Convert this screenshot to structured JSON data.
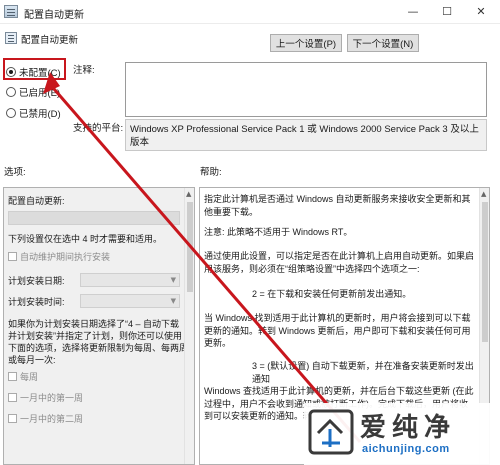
{
  "window": {
    "title": "配置自动更新",
    "controls": {
      "minimize": "—",
      "maximize": "☐",
      "close": "✕"
    }
  },
  "header": {
    "title": "配置自动更新"
  },
  "nav": {
    "prev_label": "上一个设置(P)",
    "next_label": "下一个设置(N)"
  },
  "options": {
    "not_configured": "未配置(C)",
    "enabled": "已启用(E)",
    "disabled": "已禁用(D)",
    "selected": "not_configured"
  },
  "labels": {
    "comment": "注释:",
    "platform": "支持的平台:",
    "options": "选项:",
    "help": "帮助:"
  },
  "platform_text": "Windows XP Professional Service Pack 1 或 Windows 2000 Service Pack 3 及以上版本",
  "options_panel": {
    "heading": "配置自动更新:",
    "note": "下列设置仅在选中 4 时才需要和适用。",
    "maintenance_checkbox": "自动维护期间执行安装",
    "schedule_day_label": "计划安装日期:",
    "schedule_time_label": "计划安装时间:",
    "paragraph": [
      "如果你为计划安装日期选择了“4 – 自动下载",
      "并计划安装”并指定了计划，则你还可以使用",
      "下面的选项，选择将更新限制为每周、每两周",
      "或每月一次:"
    ],
    "weekly": "每周",
    "first_week": "一月中的第一周",
    "second_week": "一月中的第二周"
  },
  "help_panel": {
    "p1": "指定此计算机是否通过 Windows 自动更新服务来接收安全更新和其他重要下载。",
    "p2": "注意: 此策略不适用于 Windows RT。",
    "p3": "通过使用此设置，可以指定是否在此计算机上启用自动更新。如果启用该服务，则必须在“组策略设置”中选择四个选项之一:",
    "p4": "2 = 在下载和安装任何更新前发出通知。",
    "p5": "当 Windows 找到适用于此计算机的更新时，用户将会接到可以下载更新的通知。转到 Windows 更新后，用户即可下载和安装任何可用更新。",
    "p6": "3 = (默认设置) 自动下载更新，并在准备安装更新时发出通知",
    "p7": "Windows 查找适用于此计算机的更新，并在后台下载这些更新 (在此过程中，用户不会收到通知或被打断工作)。完成下载后，用户将收到可以安装更新的通知。转"
  },
  "watermark": {
    "title": "爱纯净",
    "url": "aichunjing.com",
    "logo": "aichunjing-logo"
  },
  "colors": {
    "highlight": "#c8161d",
    "arrow": "#c8161d",
    "watermark_url": "#1d6fc4"
  }
}
